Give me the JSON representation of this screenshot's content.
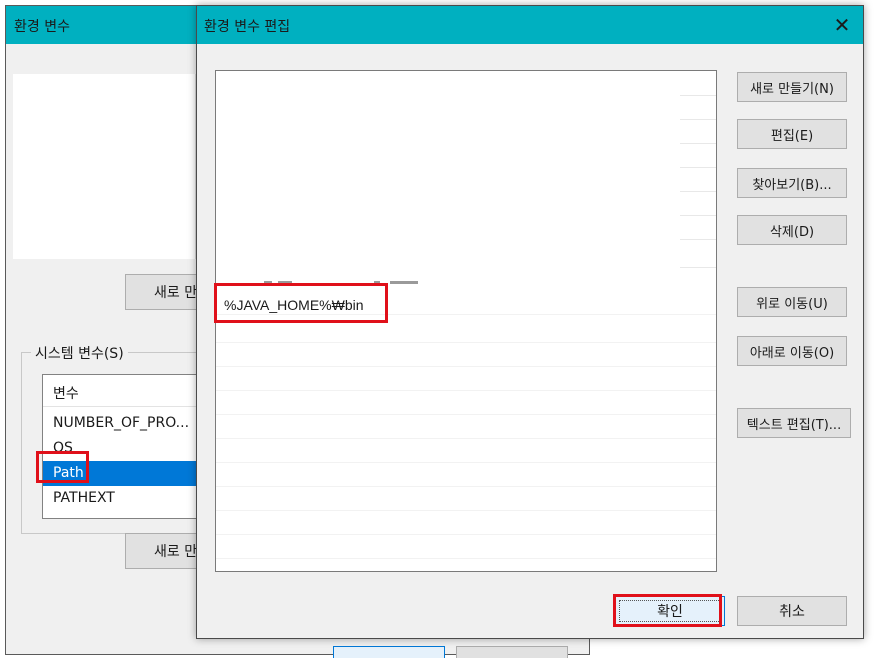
{
  "back_window": {
    "title": "환경 변수",
    "user_new_button": "새로 만",
    "system_group_label": "시스템 변수(S)",
    "system_list": {
      "header": "변수",
      "rows": [
        "NUMBER_OF_PRO...",
        "OS",
        "Path",
        "PATHEXT"
      ],
      "selected_index": 2
    },
    "system_new_button": "새로 만"
  },
  "dialog": {
    "title": "환경 변수 편집",
    "close_glyph": "✕",
    "path_entries": [
      "%JAVA_HOME%₩bin"
    ],
    "buttons": {
      "new": "새로 만들기(N)",
      "edit": "편집(E)",
      "browse": "찾아보기(B)...",
      "delete": "삭제(D)",
      "move_up": "위로 이동(U)",
      "move_down": "아래로 이동(O)",
      "edit_text": "텍스트 편집(T)...",
      "ok": "확인",
      "cancel": "취소"
    }
  },
  "colors": {
    "titlebar": "#00b0c0",
    "selection": "#0078d7",
    "highlight": "#e0101a"
  },
  "icons": [
    "close-icon"
  ]
}
